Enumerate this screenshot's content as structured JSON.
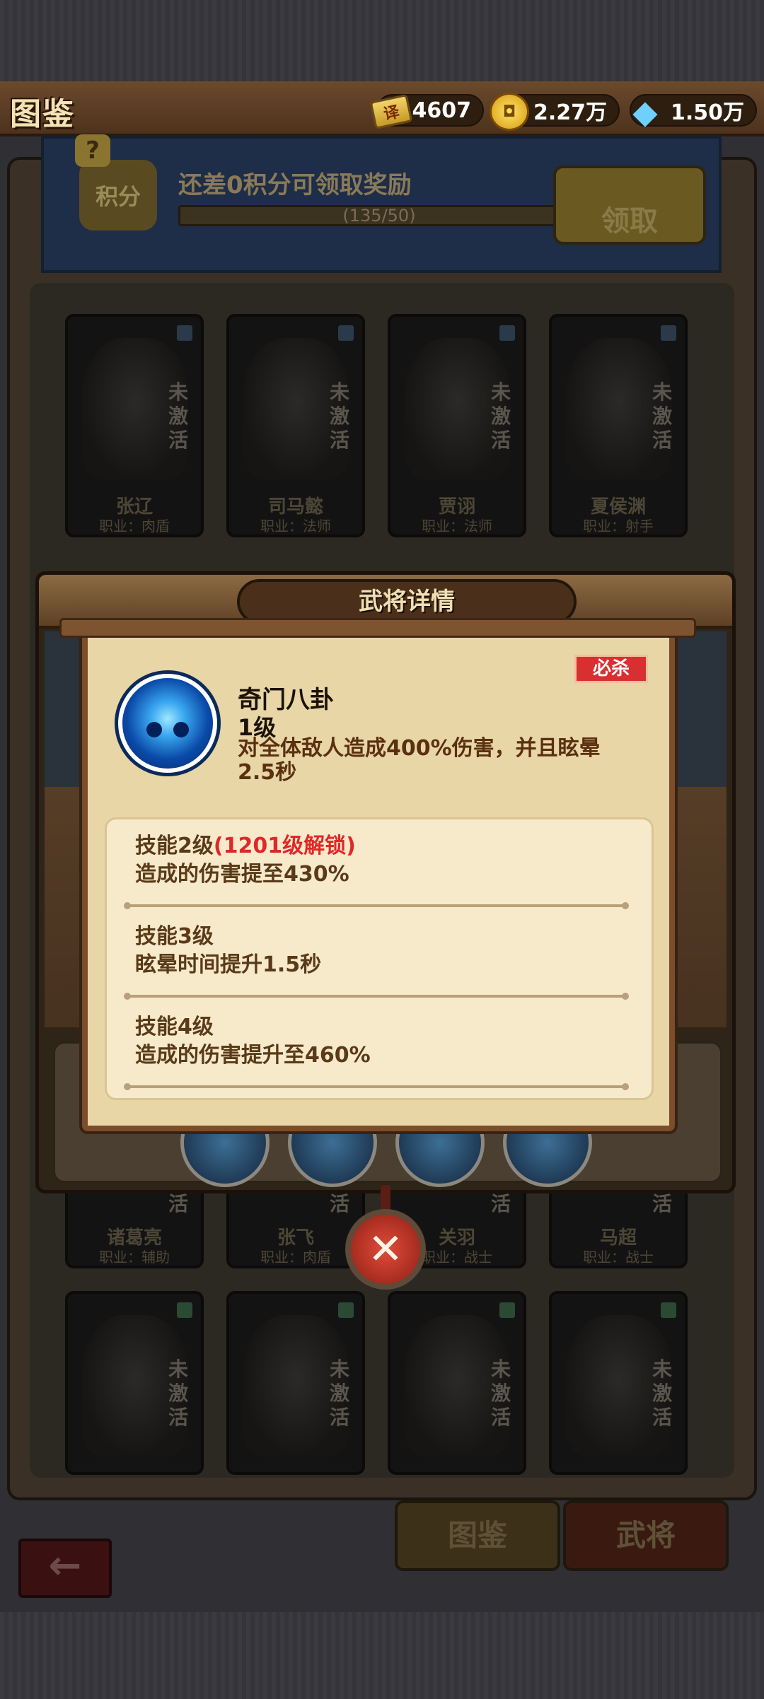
{
  "header": {
    "title": "图鉴",
    "currency": {
      "tickets": "4607",
      "coins": "2.27万",
      "gems": "1.50万"
    }
  },
  "reward": {
    "help": "?",
    "badge": "积分",
    "text": "还差0积分可领取奖励",
    "progress": "(135/50)",
    "claim": "领取"
  },
  "cards_top": [
    {
      "name": "张辽",
      "role": "职业：肉盾",
      "status": "未激活"
    },
    {
      "name": "司马懿",
      "role": "职业：法师",
      "status": "未激活"
    },
    {
      "name": "贾诩",
      "role": "职业：法师",
      "status": "未激活"
    },
    {
      "name": "夏侯渊",
      "role": "职业：射手",
      "status": "未激活"
    }
  ],
  "cards_mid": [
    {
      "name": "诸葛亮",
      "role": "职业：辅助",
      "status": "活"
    },
    {
      "name": "张飞",
      "role": "职业：肉盾",
      "status": "活"
    },
    {
      "name": "关羽",
      "role": "职业：战士",
      "status": "活"
    },
    {
      "name": "马超",
      "role": "职业：战士",
      "status": "活"
    }
  ],
  "cards_bottom": [
    {
      "status": "未激活"
    },
    {
      "status": "未激活"
    },
    {
      "status": "未激活"
    },
    {
      "status": "未激活"
    }
  ],
  "tabs": {
    "atlas": "图鉴",
    "generals": "武将"
  },
  "back": "←",
  "modal": {
    "title": "武将详情"
  },
  "skill": {
    "badge": "必杀",
    "name": "奇门八卦",
    "level": "1级",
    "description": "对全体敌人造成400%伤害，并且眩晕2.5秒",
    "upgrades": [
      {
        "title": "技能2级",
        "lock": "(1201级解锁)",
        "effect": "造成的伤害提至430%"
      },
      {
        "title": "技能3级",
        "lock": "",
        "effect": "眩晕时间提升1.5秒"
      },
      {
        "title": "技能4级",
        "lock": "",
        "effect": "造成的伤害提升至460%"
      }
    ]
  },
  "close": "✕",
  "colors": {
    "accent_red": "#e02828",
    "popup_bg": "#e8d6a6",
    "header_brown": "#6b4a2c"
  }
}
